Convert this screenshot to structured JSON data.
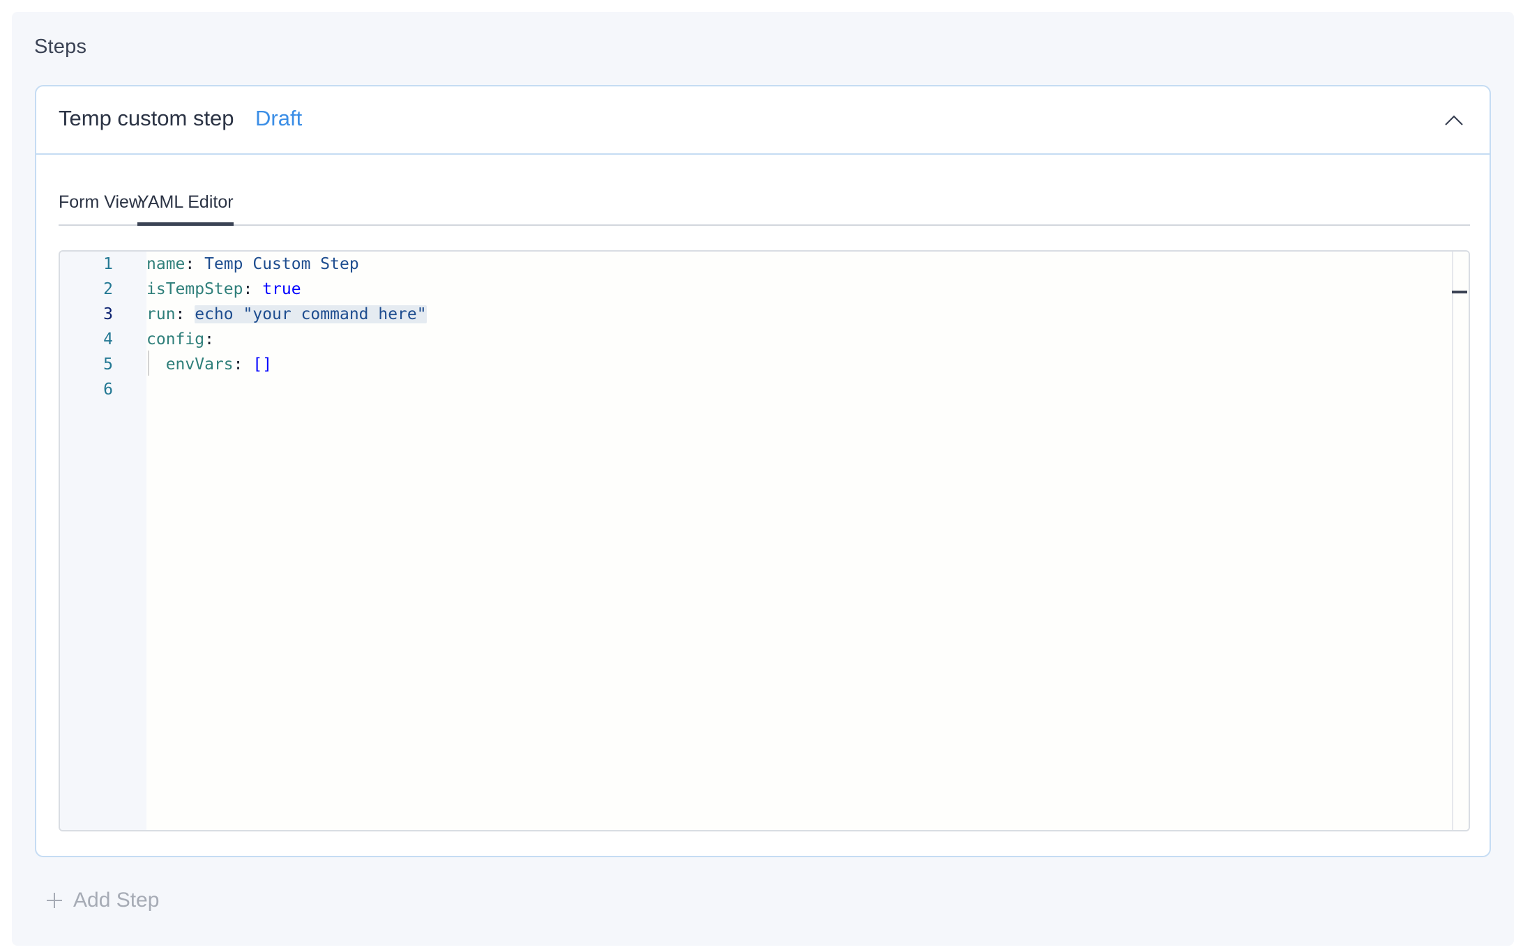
{
  "section": {
    "title": "Steps"
  },
  "step": {
    "name": "Temp custom step",
    "status": "Draft",
    "collapse_icon": "chevron-up-icon"
  },
  "tabs": [
    {
      "label": "Form View",
      "active": false
    },
    {
      "label": "YAML Editor",
      "active": true
    }
  ],
  "editor": {
    "current_line": 3,
    "line_numbers": [
      "1",
      "2",
      "3",
      "4",
      "5",
      "6"
    ],
    "lines": [
      {
        "key": "name",
        "sep": ":",
        "value": "Temp Custom Step"
      },
      {
        "key": "isTempStep",
        "sep": ":",
        "value": "true"
      },
      {
        "key": "run",
        "sep": ":",
        "value": "echo \"your command here\""
      },
      {
        "key": "config",
        "sep": ":",
        "value": ""
      },
      {
        "key": "envVars",
        "sep": ":",
        "value": "[]"
      },
      {
        "key": "",
        "sep": "",
        "value": ""
      }
    ]
  },
  "add_step": {
    "label": "Add Step",
    "icon": "plus-icon"
  },
  "colors": {
    "draft_badge": "#3b8ee6",
    "card_border": "#c5dcf3",
    "yaml_key": "#2f7f7a",
    "yaml_string": "#1e4d8f",
    "yaml_bool": "#0000ff"
  }
}
